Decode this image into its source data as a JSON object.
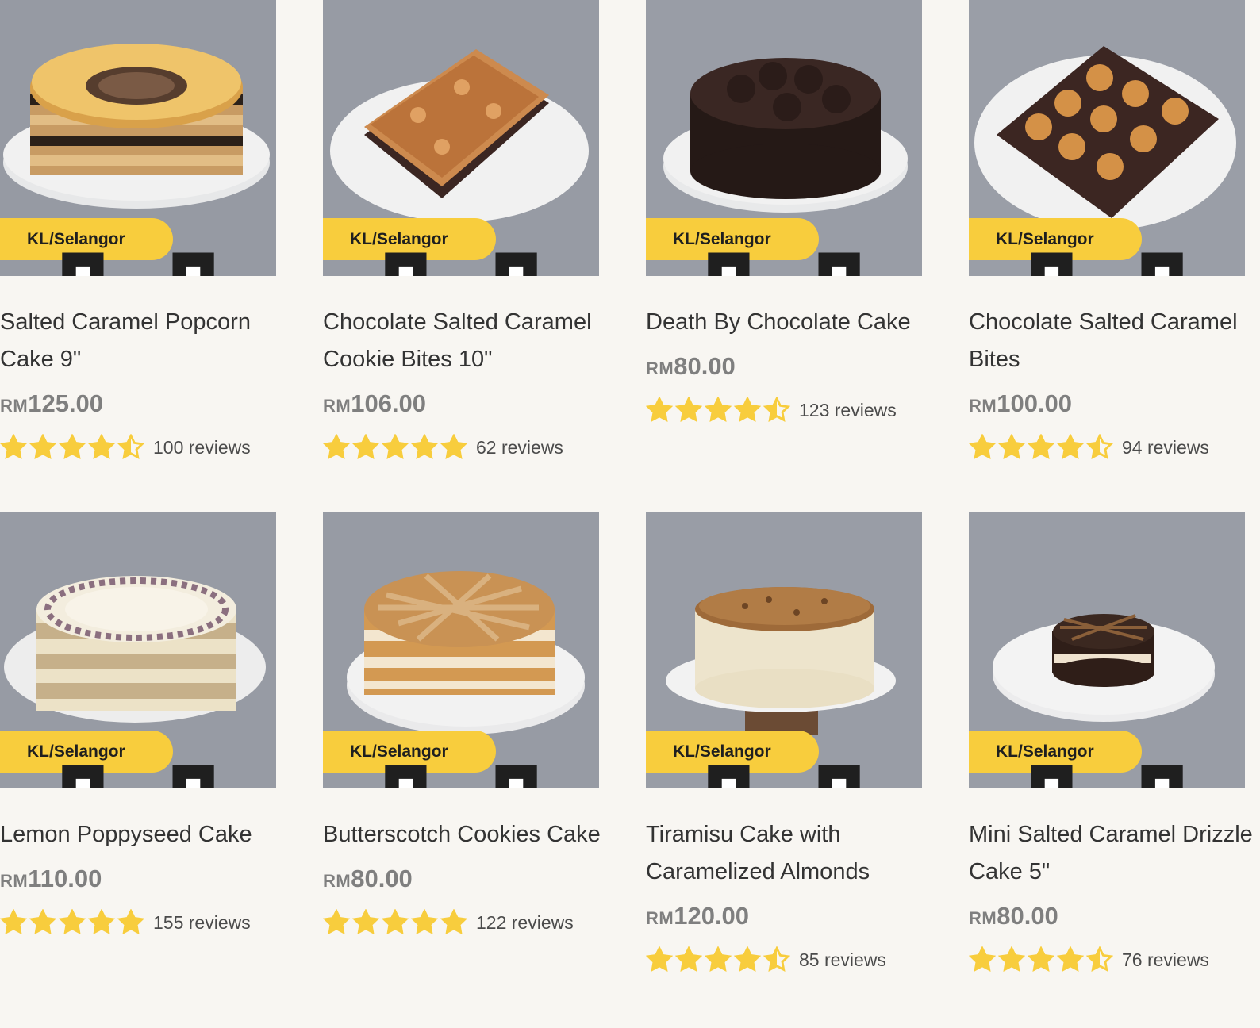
{
  "colors": {
    "badge": "#f8cd3d",
    "star": "#f8cd3d",
    "price": "#7f7f7f",
    "background": "#f8f6f2"
  },
  "products": [
    {
      "name": "Salted Caramel Popcorn Cake 9\"",
      "currency": "RM",
      "price": "125.00",
      "rating": 4.5,
      "reviews": "100 reviews",
      "badge": "KL/Selangor",
      "badge_icon": "bottles-icon",
      "image": "salted-caramel-popcorn-cake-photo"
    },
    {
      "name": "Chocolate Salted Caramel Cookie Bites 10\"",
      "currency": "RM",
      "price": "106.00",
      "rating": 5,
      "reviews": "62 reviews",
      "badge": "KL/Selangor",
      "badge_icon": "bottles-icon",
      "image": "chocolate-salted-caramel-cookie-bites-photo"
    },
    {
      "name": "Death By Chocolate Cake",
      "currency": "RM",
      "price": "80.00",
      "rating": 4.5,
      "reviews": "123 reviews",
      "badge": "KL/Selangor",
      "badge_icon": "bottles-icon",
      "image": "death-by-chocolate-cake-photo"
    },
    {
      "name": "Chocolate Salted Caramel Bites",
      "currency": "RM",
      "price": "100.00",
      "rating": 4.5,
      "reviews": "94 reviews",
      "badge": "KL/Selangor",
      "badge_icon": "bottles-icon",
      "image": "chocolate-salted-caramel-bites-photo"
    },
    {
      "name": "Lemon Poppyseed Cake",
      "currency": "RM",
      "price": "110.00",
      "rating": 5,
      "reviews": "155 reviews",
      "badge": "KL/Selangor",
      "badge_icon": "bottles-icon",
      "image": "lemon-poppyseed-cake-photo"
    },
    {
      "name": "Butterscotch Cookies Cake",
      "currency": "RM",
      "price": "80.00",
      "rating": 5,
      "reviews": "122 reviews",
      "badge": "KL/Selangor",
      "badge_icon": "bottles-icon",
      "image": "butterscotch-cookies-cake-photo"
    },
    {
      "name": "Tiramisu Cake with Caramelized Almonds",
      "currency": "RM",
      "price": "120.00",
      "rating": 4.5,
      "reviews": "85 reviews",
      "badge": "KL/Selangor",
      "badge_icon": "bottles-icon",
      "image": "tiramisu-cake-photo"
    },
    {
      "name": "Mini Salted Caramel Drizzle Cake 5\"",
      "currency": "RM",
      "price": "80.00",
      "rating": 4.5,
      "reviews": "76 reviews",
      "badge": "KL/Selangor",
      "badge_icon": "bottles-icon",
      "image": "mini-salted-caramel-drizzle-cake-photo"
    }
  ]
}
